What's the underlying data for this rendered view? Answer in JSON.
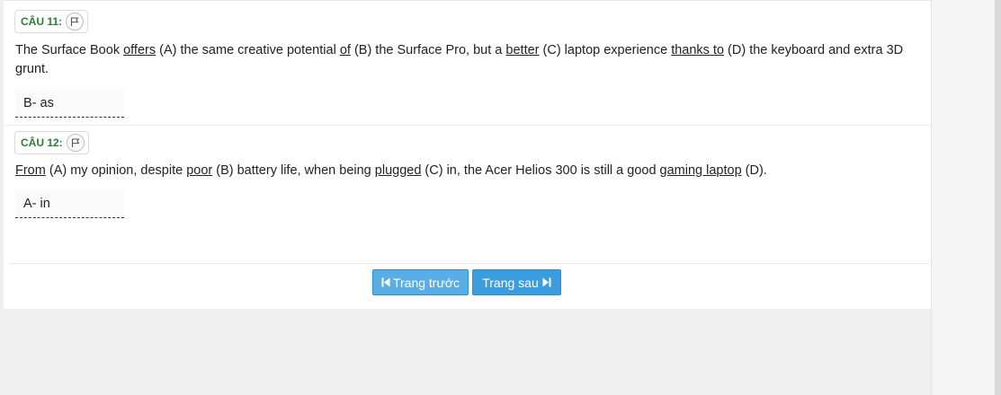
{
  "questions": [
    {
      "label": "CÂU 11:",
      "segments": [
        {
          "t": "The Surface Book ",
          "u": false
        },
        {
          "t": "offers",
          "u": true
        },
        {
          "t": " (A) the same creative potential ",
          "u": false
        },
        {
          "t": "of",
          "u": true
        },
        {
          "t": " (B) the Surface Pro, but a ",
          "u": false
        },
        {
          "t": "better",
          "u": true
        },
        {
          "t": " (C) laptop experience ",
          "u": false
        },
        {
          "t": "thanks to",
          "u": true
        },
        {
          "t": " (D) the keyboard and extra 3D grunt.",
          "u": false
        }
      ],
      "answer": "B- as"
    },
    {
      "label": "CÂU 12:",
      "segments": [
        {
          "t": "From",
          "u": true
        },
        {
          "t": " (A) my opinion, despite ",
          "u": false
        },
        {
          "t": "poor",
          "u": true
        },
        {
          "t": " (B) battery life, when being ",
          "u": false
        },
        {
          "t": "plugged",
          "u": true
        },
        {
          "t": " (C) in, the Acer Helios 300 is still a good ",
          "u": false
        },
        {
          "t": "gaming laptop",
          "u": true
        },
        {
          "t": " (D).",
          "u": false
        }
      ],
      "answer": "A- in"
    }
  ],
  "nav": {
    "prev_label": "Trang trước",
    "next_label": "Trang sau",
    "prev_icon": "skip-back-icon",
    "next_icon": "skip-forward-icon"
  },
  "colors": {
    "question_label": "#2e7d32",
    "button": "#3b9ddd",
    "background": "#efefef"
  }
}
